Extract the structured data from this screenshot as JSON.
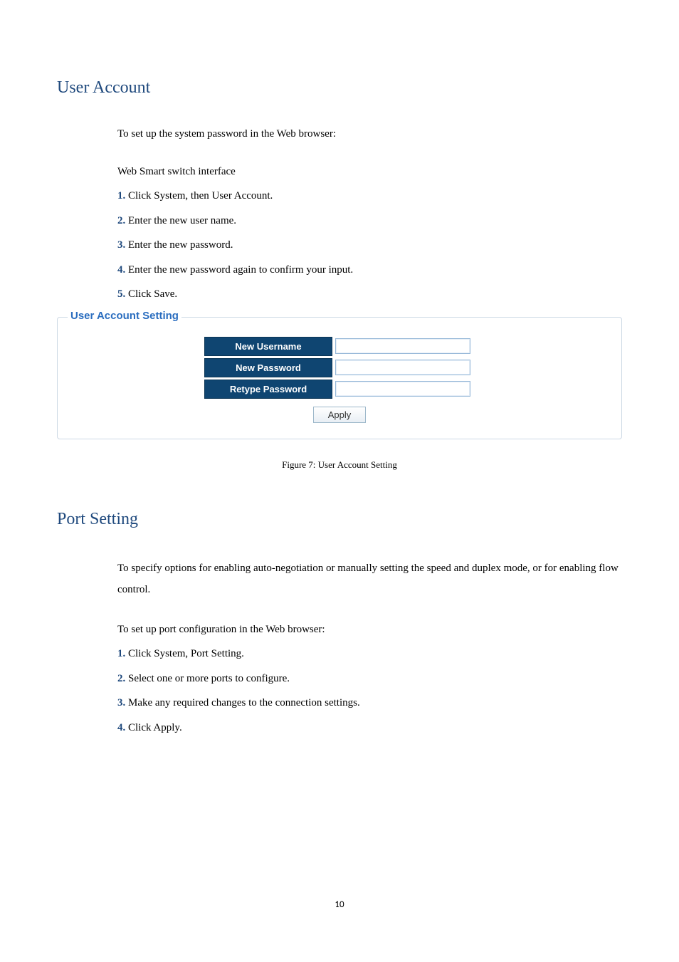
{
  "section1": {
    "heading": "User Account",
    "intro": "To set up the system password in the Web browser:",
    "sub_intro": "Web Smart switch interface",
    "steps": [
      {
        "num": "1.",
        "text": " Click System, then User Account."
      },
      {
        "num": "2.",
        "text": " Enter the new user name."
      },
      {
        "num": "3.",
        "text": " Enter the new password."
      },
      {
        "num": "4.",
        "text": " Enter the new password again to confirm your input."
      },
      {
        "num": "5.",
        "text": " Click Save."
      }
    ]
  },
  "panel": {
    "legend": "User Account Setting",
    "fields": {
      "new_username": "New Username",
      "new_password": "New Password",
      "retype_password": "Retype Password"
    },
    "apply": "Apply"
  },
  "caption": "Figure 7: User Account Setting",
  "section2": {
    "heading": "Port Setting",
    "intro": "To specify options for enabling auto-negotiation or manually setting the speed and duplex mode, or for enabling flow control.",
    "sub_intro": "To set up port configuration in the Web browser:",
    "steps": [
      {
        "num": "1.",
        "text": " Click System, Port Setting."
      },
      {
        "num": "2.",
        "text": " Select one or more ports to configure."
      },
      {
        "num": "3.",
        "text": " Make any required changes to the connection settings."
      },
      {
        "num": "4.",
        "text": " Click Apply."
      }
    ]
  },
  "page_number": "10"
}
